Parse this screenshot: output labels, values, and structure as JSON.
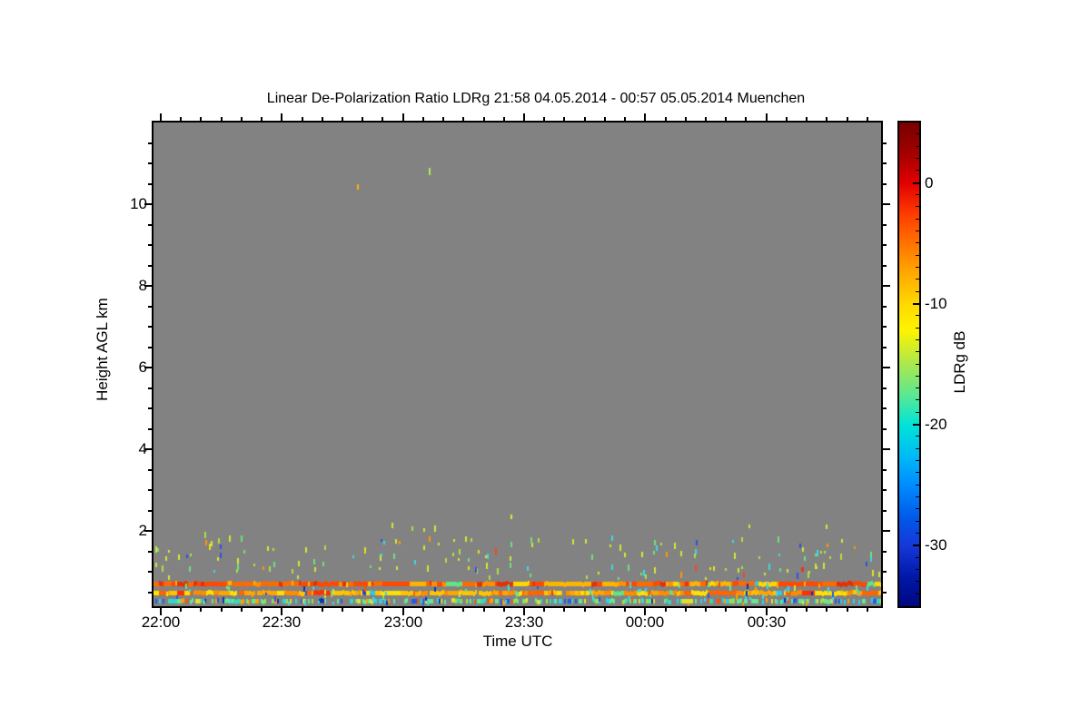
{
  "window": {
    "background": "#ffffff"
  },
  "chart_data": {
    "type": "heatmap",
    "title": "Linear De-Polarization Ratio LDRg   21:58 04.05.2014 - 00:57 05.05.2014 Muenchen",
    "instrument_quantity": "Linear De-Polarization Ratio LDRg",
    "time_start": "21:58 04.05.2014",
    "time_end": "00:57 05.05.2014",
    "site": "Muenchen",
    "xlabel": "Time UTC",
    "ylabel": "Height AGL km",
    "x_tick_labels": [
      "22:00",
      "22:30",
      "23:00",
      "23:30",
      "00:00",
      "00:30"
    ],
    "x_major_interval_min": 30,
    "x_minor_interval_min": 5,
    "y_tick_labels": [
      "2",
      "4",
      "6",
      "8",
      "10"
    ],
    "y_major_km": [
      2,
      4,
      6,
      8,
      10
    ],
    "y_minor_interval_km": 0.5,
    "y_range_km": [
      0.15,
      12.0
    ],
    "grid": false,
    "legend": "colorbar-right",
    "no_data_color": "#828282",
    "axis_color": "#000000",
    "colorbar": {
      "label": "LDRg dB",
      "tick_labels": [
        "0",
        "-10",
        "-20",
        "-30"
      ],
      "tick_values": [
        0,
        -10,
        -20,
        -30
      ],
      "max_db": 5,
      "min_db": -35,
      "minor_tick_db": 1,
      "gradient": [
        [
          0.0,
          "#780000"
        ],
        [
          0.06,
          "#a00000"
        ],
        [
          0.125,
          "#e10000"
        ],
        [
          0.19,
          "#ff3c00"
        ],
        [
          0.25,
          "#ff7300"
        ],
        [
          0.31,
          "#ffa700"
        ],
        [
          0.375,
          "#ffd800"
        ],
        [
          0.43,
          "#fdf400"
        ],
        [
          0.5,
          "#aae84e"
        ],
        [
          0.56,
          "#5fe88e"
        ],
        [
          0.625,
          "#00e4d8"
        ],
        [
          0.69,
          "#00baf5"
        ],
        [
          0.75,
          "#008cff"
        ],
        [
          0.82,
          "#0058e8"
        ],
        [
          0.875,
          "#1638d8"
        ],
        [
          0.94,
          "#0018a8"
        ],
        [
          1.0,
          "#000780"
        ]
      ]
    },
    "features": {
      "seed": 20140504,
      "bands": [
        {
          "name": "clutter-band-0.7km",
          "km_top": 0.76,
          "km_bottom": 0.64,
          "coverage": 1.0,
          "run_keep": 0.72,
          "palette": [
            [
              "#e63000",
              22
            ],
            [
              "#ff4800",
              24
            ],
            [
              "#ff6a00",
              20
            ],
            [
              "#ff9000",
              14
            ],
            [
              "#ffb400",
              9
            ],
            [
              "#ffd700",
              6
            ],
            [
              "#64e284",
              2
            ],
            [
              "#32c8e0",
              2
            ],
            [
              "#2040d0",
              1
            ]
          ]
        },
        {
          "name": "clutter-band-0.5km",
          "km_top": 0.53,
          "km_bottom": 0.42,
          "coverage": 0.98,
          "run_keep": 0.7,
          "palette": [
            [
              "#ff8c00",
              22
            ],
            [
              "#ffa500",
              24
            ],
            [
              "#ffc400",
              20
            ],
            [
              "#ffe000",
              12
            ],
            [
              "#ff6400",
              10
            ],
            [
              "#ff3000",
              5
            ],
            [
              "#64e284",
              3
            ],
            [
              "#32c8e0",
              2
            ],
            [
              "#2040d0",
              2
            ]
          ]
        },
        {
          "name": "speckle-band-0.3km",
          "km_top": 0.34,
          "km_bottom": 0.22,
          "coverage": 0.58,
          "run_keep": 0.55,
          "palette": [
            [
              "#64e890",
              24
            ],
            [
              "#3cd8b0",
              10
            ],
            [
              "#30d0e8",
              18
            ],
            [
              "#a0e040",
              12
            ],
            [
              "#e0e030",
              12
            ],
            [
              "#ffa000",
              8
            ],
            [
              "#ff5000",
              5
            ],
            [
              "#2858e8",
              7
            ],
            [
              "#1030b0",
              4
            ]
          ]
        }
      ],
      "scatter": [
        {
          "name": "boundary-layer-specks",
          "km_min": 0.78,
          "km_max": 1.75,
          "count": 150,
          "palette": [
            [
              "#d4e830",
              30
            ],
            [
              "#b0e040",
              20
            ],
            [
              "#70e080",
              15
            ],
            [
              "#e8e020",
              12
            ],
            [
              "#40d8e0",
              10
            ],
            [
              "#ff9800",
              5
            ],
            [
              "#ff4020",
              3
            ],
            [
              "#3050e0",
              5
            ]
          ]
        },
        {
          "name": "upper-specks",
          "km_min": 1.5,
          "km_max": 2.1,
          "count": 12,
          "palette": [
            [
              "#d4e830",
              50
            ],
            [
              "#b0e040",
              25
            ],
            [
              "#70e080",
              15
            ],
            [
              "#40d8e0",
              10
            ]
          ]
        },
        {
          "name": "near-ground-specks",
          "km_min": 0.16,
          "km_max": 0.62,
          "count": 90,
          "palette": [
            [
              "#40d8e0",
              25
            ],
            [
              "#70e080",
              20
            ],
            [
              "#d4e830",
              15
            ],
            [
              "#2858e8",
              15
            ],
            [
              "#ffa000",
              10
            ],
            [
              "#ff5000",
              5
            ],
            [
              "#1030b0",
              10
            ]
          ]
        }
      ],
      "points": [
        {
          "name": "high-altitude-speck-1",
          "x_frac": 0.2797,
          "km": 10.35,
          "color": "#ffb400",
          "w": 2,
          "h": 6
        },
        {
          "name": "high-altitude-speck-2",
          "x_frac": 0.3783,
          "km": 10.72,
          "color": "#b4e85c",
          "w": 2,
          "h": 8
        },
        {
          "name": "mid-level-speck",
          "x_frac": 0.4907,
          "km": 2.3,
          "color": "#e8e830",
          "w": 2,
          "h": 5
        },
        {
          "name": "red-speck",
          "x_frac": 0.89,
          "km": 1.0,
          "color": "#f03218",
          "w": 3,
          "h": 5
        }
      ]
    }
  }
}
